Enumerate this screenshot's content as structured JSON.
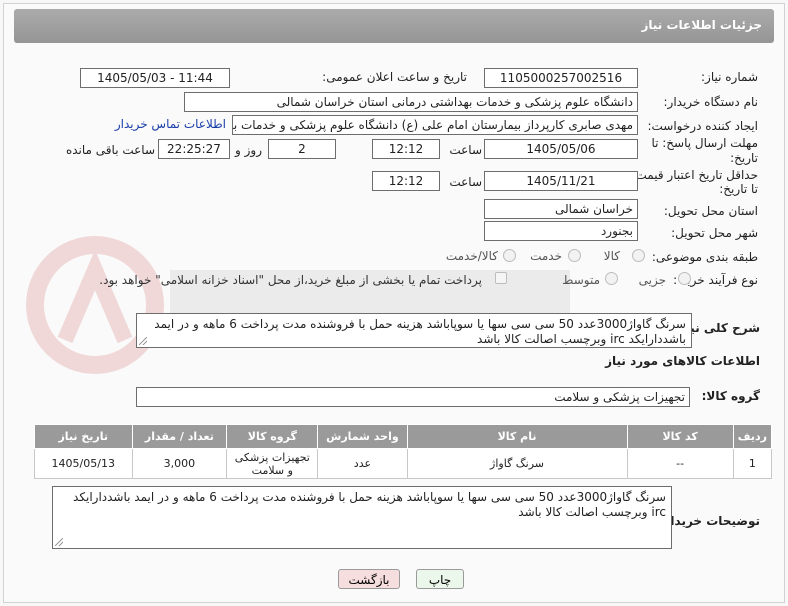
{
  "header": {
    "title": "جزئیات اطلاعات نیاز"
  },
  "fields": {
    "need_number_label": "شماره نیاز:",
    "need_number": "1105000257002516",
    "announce_label": "تاریخ و ساعت اعلان عمومی:",
    "announce_value": "1405/05/03 - 11:44",
    "buyer_org_label": "نام دستگاه خریدار:",
    "buyer_org": "دانشگاه علوم پزشکی و خدمات بهداشتی درمانی استان خراسان شمالی",
    "creator_label": "ایجاد کننده درخواست:",
    "creator": "مهدی صابری کارپرداز بیمارستان امام علی (ع) دانشگاه علوم پزشکی و خدمات بهداشتی",
    "contact_link": "اطلاعات تماس خریدار",
    "deadline_label_1": "مهلت ارسال پاسخ: تا",
    "deadline_label_2": "تاریخ:",
    "deadline_date": "1405/05/06",
    "time_label": "ساعت",
    "deadline_time": "12:12",
    "days_value": "2",
    "days_label": "روز و",
    "remaining_time": "22:25:27",
    "remaining_label": "ساعت باقی مانده",
    "min_price_label_1": "حداقل تاریخ اعتبار قیمت:",
    "min_price_label_2": "تا تاریخ:",
    "price_date": "1405/11/21",
    "price_time": "12:12",
    "province_label": "استان محل تحویل:",
    "province": "خراسان شمالی",
    "city_label": "شهر محل تحویل:",
    "city": "بجنورد",
    "category_label": "طبقه بندی موضوعی:",
    "category_options": [
      "کالا",
      "خدمت",
      "کالا/خدمت"
    ],
    "process_label": "نوع فرآیند خرید :",
    "process_options": [
      "جزیی",
      "متوسط"
    ],
    "payment_note": "پرداخت تمام یا بخشی از مبلغ خرید،از محل \"اسناد خزانه اسلامی\" خواهد بود."
  },
  "description": {
    "label": "شرح کلی نیاز:",
    "text": "سرنگ گاواژ3000عدد 50 سی سی سها  یا سوپاباشد هزینه حمل با فروشنده مدت پرداخت 6 ماهه و در ایمد باشددارایکد irc وبرچسب اصالت کالا باشد"
  },
  "goods": {
    "section_title": "اطلاعات کالاهای مورد نیاز",
    "group_label": "گروه کالا:",
    "group_value": "تجهیزات پزشکی و سلامت"
  },
  "table": {
    "headers": [
      "ردیف",
      "کد کالا",
      "نام کالا",
      "واحد شمارش",
      "گروه کالا",
      "تعداد / مقدار",
      "تاریخ نیاز"
    ],
    "rows": [
      [
        "1",
        "--",
        "سرنگ گاواژ",
        "عدد",
        "تجهیزات پزشکی و سلامت",
        "3,000",
        "1405/05/13"
      ]
    ]
  },
  "buyer_notes": {
    "label": "توضیحات خریدار:",
    "text": "سرنگ گاواژ3000عدد 50 سی سی سها  یا سوپاباشد هزینه حمل با فروشنده مدت پرداخت 6 ماهه و در ایمد باشددارایکد irc وبرچسب اصالت کالا باشد"
  },
  "buttons": {
    "print": "چاپ",
    "back": "بازگشت"
  },
  "colors": {
    "header": "#9e9e9e",
    "link": "#1a3ea8",
    "back_button": "#f7dede",
    "print_button": "#ecf7ec"
  }
}
